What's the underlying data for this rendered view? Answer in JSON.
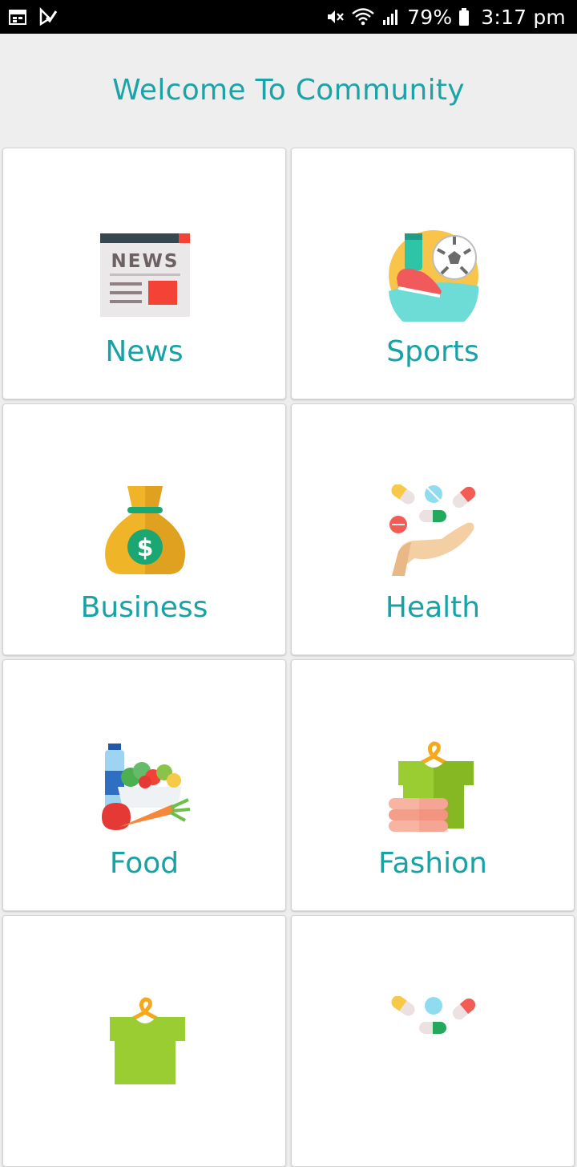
{
  "status_bar": {
    "battery": "79%",
    "time": "3:17 pm",
    "icons": [
      "calendar-icon",
      "check-icon",
      "mute-icon",
      "wifi-icon",
      "signal-icon",
      "battery-icon"
    ]
  },
  "header": {
    "title": "Welcome To Community"
  },
  "categories": [
    {
      "label": "News",
      "icon": "newspaper-icon"
    },
    {
      "label": "Sports",
      "icon": "soccer-icon"
    },
    {
      "label": "Business",
      "icon": "money-bag-icon"
    },
    {
      "label": "Health",
      "icon": "pills-hand-icon"
    },
    {
      "label": "Food",
      "icon": "food-icon"
    },
    {
      "label": "Fashion",
      "icon": "clothes-icon"
    },
    {
      "label": "",
      "icon": "clothes-icon"
    },
    {
      "label": "",
      "icon": "pills-hand-icon"
    }
  ],
  "colors": {
    "accent": "#17a2a6",
    "background": "#eeeeee",
    "card": "#ffffff"
  }
}
